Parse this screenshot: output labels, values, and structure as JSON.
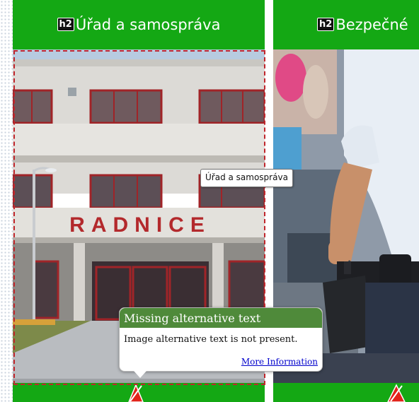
{
  "cards": [
    {
      "heading_tag": "h2",
      "title": "Úřad a samospráva",
      "building_sign": "RADNICE"
    },
    {
      "heading_tag": "h2",
      "title": "Bezpečné"
    }
  ],
  "hover_tooltip": "Úřad a samospráva",
  "alt_check": {
    "title": "Missing alternative text",
    "message": "Image alternative text is not present.",
    "link": "More Information"
  },
  "colors": {
    "card_green": "#14a814",
    "popup_header": "#4f8a3a",
    "outline_red": "#c0262c",
    "warning_red": "#e2231a"
  }
}
